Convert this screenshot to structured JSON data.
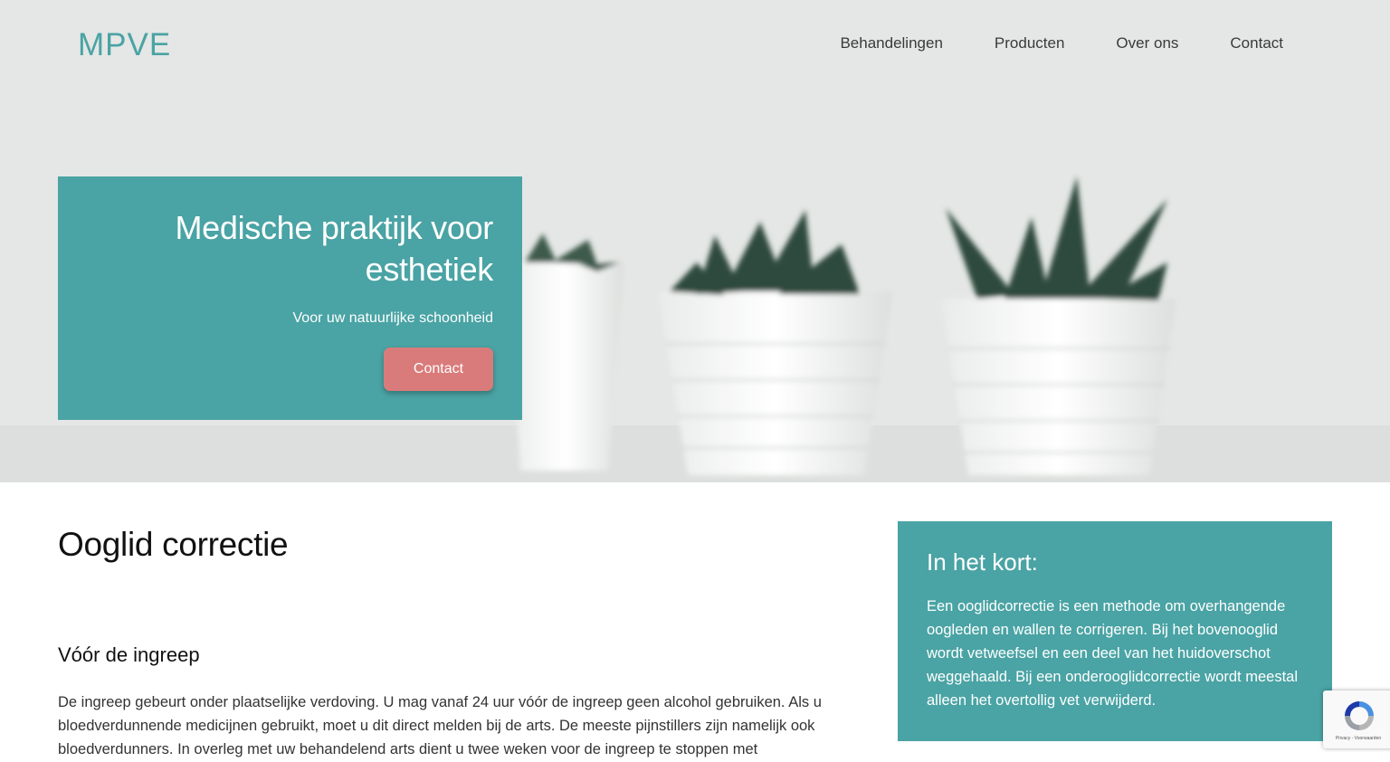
{
  "header": {
    "logo": "MPVE",
    "nav": [
      "Behandelingen",
      "Producten",
      "Over ons",
      "Contact"
    ]
  },
  "hero": {
    "title_line1": "Medische praktijk voor",
    "title_line2": "esthetiek",
    "subtitle": "Voor uw natuurlijke schoonheid",
    "button_label": "Contact"
  },
  "main": {
    "page_title": "Ooglid correctie",
    "section_title": "Vóór de ingreep",
    "section_text": "De ingreep gebeurt onder plaatselijke verdoving. U mag vanaf 24 uur vóór de ingreep geen alcohol gebruiken. Als u bloedverdunnende medicijnen gebruikt, moet u dit direct melden bij de arts. De meeste pijnstillers zijn namelijk ook bloedverdunners. In overleg met uw behandelend arts dient u twee weken voor de ingreep te stoppen met"
  },
  "aside": {
    "title": "In het kort:",
    "text": "Een ooglidcorrectie is een methode om overhangende oogleden en wallen te corrigeren. Bij het bovenooglid wordt vetweefsel en een deel van het huidoverschot weggehaald. Bij een onderooglidcorrectie wordt meestal alleen het overtollig vet verwijderd."
  },
  "recaptcha": {
    "label": "Privacy - Voorwaarden"
  },
  "colors": {
    "accent": "#4aa3a4",
    "button": "#d97b7a"
  }
}
